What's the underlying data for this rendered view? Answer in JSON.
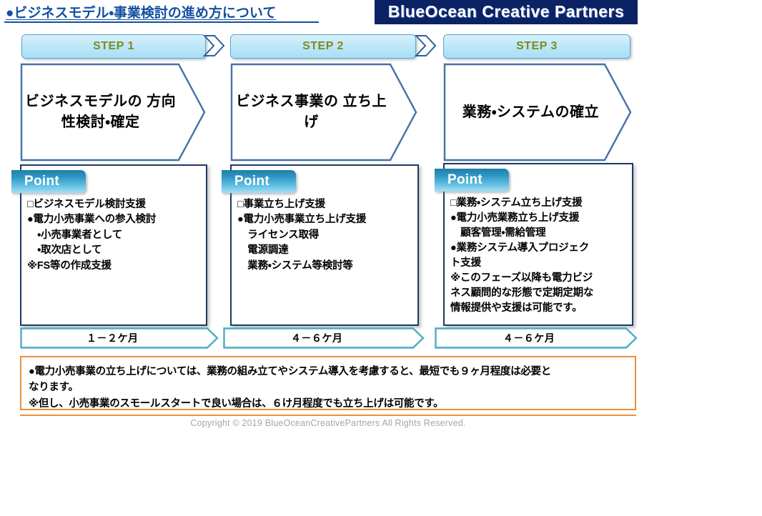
{
  "header": {
    "title": "●ビジネスモデル・事業検討の進め方について",
    "logo": "BlueOcean  Creative  Partners",
    "logo_bg": "#0b2265",
    "title_color": "#1150a0"
  },
  "steps": [
    {
      "step_label": "STEP 1",
      "phase_title": "ビジネスモデルの\n方向性検討・確定",
      "point_label": "Point",
      "point_body": "□ビジネスモデル検討支援\n●電力小売事業への参入検討\n　・小売事業者として\n　・取次店として\n※FS等の作成支援",
      "duration": "１－２ケ月"
    },
    {
      "step_label": "STEP 2",
      "phase_title": "ビジネス事業の\n立ち上げ",
      "point_label": "Point",
      "point_body": "□事業立ち上げ支援\n●電力小売事業立ち上げ支援\n　ライセンス取得\n　電源調達\n　業務・システム等検討等",
      "duration": "４－６ケ月"
    },
    {
      "step_label": "STEP 3",
      "phase_title": "業務・システムの確立",
      "point_label": "Point",
      "point_body": "□業務・システム立ち上げ支援\n●電力小売業務立ち上げ支援\n　顧客管理・需給管理\n●業務システム導入プロジェク\nト支援\n※このフェーズ以降も電力ビジ\nネス顧問的な形態で定期定期な\n情報提供や支援は可能です。",
      "duration": "４－６ケ月"
    }
  ],
  "note": {
    "text": "●電力小売事業の立ち上げについては、業務の組み立てやシステム導入を考慮すると、最短でも９ヶ月程度は必要と\nなります。\n※但し、小売事業のスモールスタートで良い場合は、６け月程度でも立ち上げは可能です。",
    "border_color": "#e8913c"
  },
  "footer": {
    "copyright": "Copyright © 2019 BlueOceanCreativePartners  All Rights Reserved."
  },
  "colors": {
    "step_header_text": "#7a8b20",
    "step_header_border": "#53a9d8",
    "phase_border": "#4472a8",
    "point_border": "#1f3864",
    "point_tab_gradient_start": "#1f7fa8",
    "point_tab_gradient_end": "#a7dff4",
    "duration_border": "#4bacc6",
    "arrow_border": "#2e5f9e"
  },
  "icons": {
    "step_arrow": "chevron-right-arrow",
    "phase_shape": "pentagon-arrow",
    "duration_shape": "pentagon-arrow-thin"
  }
}
